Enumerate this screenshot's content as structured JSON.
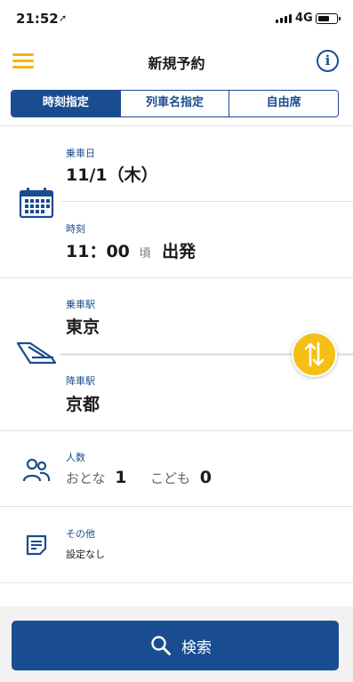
{
  "status_bar": {
    "time": "21:52",
    "network": "4G"
  },
  "nav": {
    "title": "新規予約"
  },
  "tabs": [
    {
      "label": "時刻指定"
    },
    {
      "label": "列車名指定"
    },
    {
      "label": "自由席"
    }
  ],
  "date": {
    "label": "乗車日",
    "value": "11/1（木）"
  },
  "time": {
    "label": "時刻",
    "value": "11：00",
    "approx": "頃",
    "suffix": "出発"
  },
  "departure": {
    "label": "乗車駅",
    "value": "東京"
  },
  "arrival": {
    "label": "降車駅",
    "value": "京都"
  },
  "passengers": {
    "label": "人数",
    "adult_label": "おとな",
    "adult_count": "1",
    "child_label": "こども",
    "child_count": "0"
  },
  "other": {
    "label": "その他",
    "value": "設定なし"
  },
  "search": {
    "label": "検索"
  },
  "colors": {
    "brand_blue": "#1a4d8f",
    "accent_yellow": "#f3b700"
  }
}
